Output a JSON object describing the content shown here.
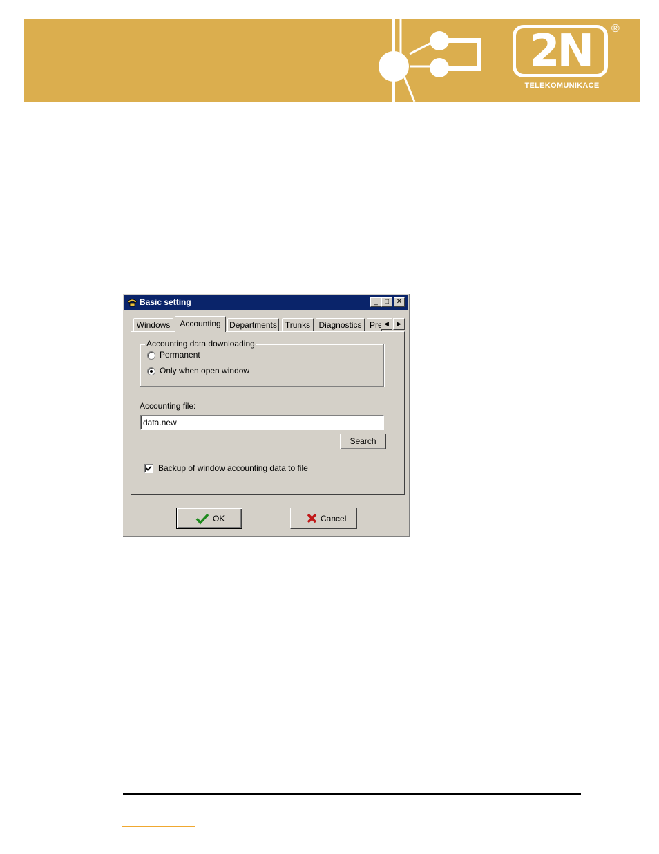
{
  "brand": {
    "logo_text": "2N",
    "registered_mark": "®",
    "subtitle": "TELEKOMUNIKACE",
    "banner_color": "#dbae4e"
  },
  "window": {
    "title": "Basic setting",
    "title_icon": "telephone-icon",
    "controls": {
      "minimize": "_",
      "maximize": "□",
      "close": "✕"
    },
    "titlebar_color": "#0a246a"
  },
  "tabs": {
    "items": [
      {
        "label": "Windows",
        "active": false
      },
      {
        "label": "Accounting",
        "active": true
      },
      {
        "label": "Departments",
        "active": false
      },
      {
        "label": "Trunks",
        "active": false
      },
      {
        "label": "Diagnostics",
        "active": false
      },
      {
        "label": "Pre",
        "active": false
      }
    ],
    "scroll_left": "◀",
    "scroll_right": "▶"
  },
  "accounting": {
    "group_label": "Accounting data downloading",
    "options": [
      {
        "label": "Permanent",
        "selected": false
      },
      {
        "label": "Only when open window",
        "selected": true
      }
    ],
    "file_label": "Accounting file:",
    "file_value": "data.new",
    "search_label": "Search",
    "backup_label": "Backup of window accounting data to file",
    "backup_checked": true
  },
  "buttons": {
    "ok_label": "OK",
    "ok_icon": "checkmark-icon",
    "cancel_label": "Cancel",
    "cancel_icon": "x-cross-icon"
  }
}
